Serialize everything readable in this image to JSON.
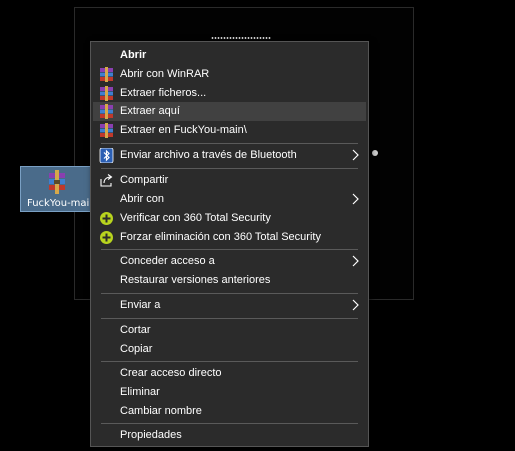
{
  "desktop_file": {
    "name": "FuckYou-main"
  },
  "context_menu": {
    "items": [
      {
        "label": "Abrir",
        "icon": "none"
      },
      {
        "label": "Abrir con WinRAR",
        "icon": "winrar-icon"
      },
      {
        "label": "Extraer ficheros...",
        "icon": "winrar-icon"
      },
      {
        "label": "Extraer aquí",
        "icon": "winrar-icon"
      },
      {
        "label": "Extraer en FuckYou-main\\",
        "icon": "winrar-icon"
      },
      {
        "label": "Enviar archivo a través de Bluetooth",
        "icon": "bluetooth-icon",
        "submenu": true
      },
      {
        "label": "Compartir",
        "icon": "share-icon"
      },
      {
        "label": "Abrir con",
        "icon": "none",
        "submenu": true
      },
      {
        "label": "Verificar con 360 Total Security",
        "icon": "360-security-icon"
      },
      {
        "label": "Forzar eliminación con 360 Total Security",
        "icon": "360-security-icon"
      },
      {
        "label": "Conceder acceso a",
        "icon": "none",
        "submenu": true
      },
      {
        "label": "Restaurar versiones anteriores",
        "icon": "none"
      },
      {
        "label": "Enviar a",
        "icon": "none",
        "submenu": true
      },
      {
        "label": "Cortar",
        "icon": "none"
      },
      {
        "label": "Copiar",
        "icon": "none"
      },
      {
        "label": "Crear acceso directo",
        "icon": "none"
      },
      {
        "label": "Eliminar",
        "icon": "none"
      },
      {
        "label": "Cambiar nombre",
        "icon": "none"
      },
      {
        "label": "Propiedades",
        "icon": "none"
      }
    ],
    "highlighted_item": "Extraer aquí"
  },
  "colors": {
    "menu_background": "#2b2b2b",
    "menu_highlight": "#414141",
    "menu_border": "#555555",
    "separator": "#5a5a5a",
    "text": "#ffffff",
    "desktop_selection": "#4a6b8a"
  }
}
